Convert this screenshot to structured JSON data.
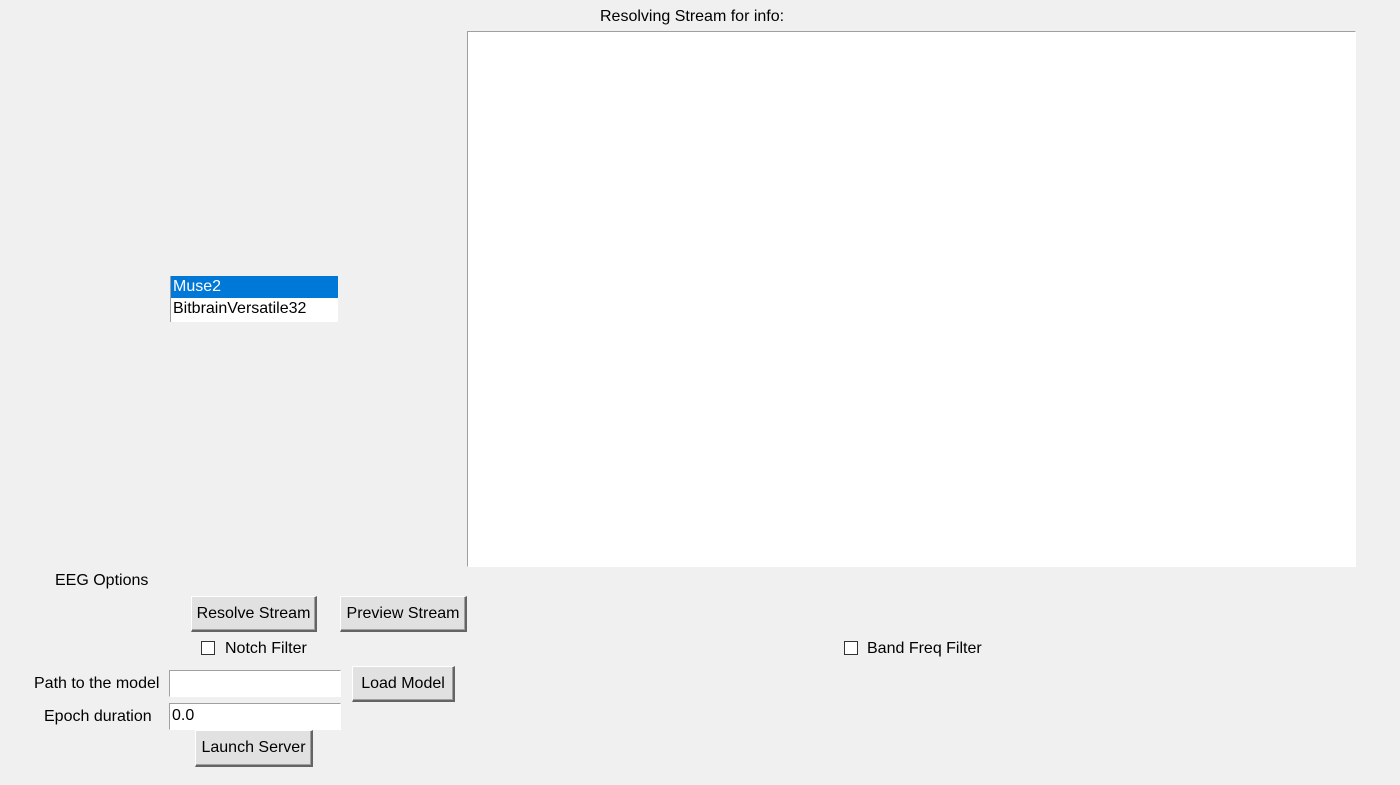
{
  "stream_info": {
    "title": "Resolving Stream for info:",
    "content": ""
  },
  "devices": {
    "items": [
      "Muse2",
      "BitbrainVersatile32"
    ],
    "selected_index": 0
  },
  "eeg_options": {
    "title": "EEG Options",
    "resolve_button": "Resolve Stream",
    "preview_button": "Preview Stream",
    "notch_filter": {
      "label": "Notch Filter",
      "checked": false
    },
    "band_filter": {
      "label": "Band Freq Filter",
      "checked": false
    }
  },
  "model": {
    "path_label": "Path to the model",
    "path_value": "",
    "load_button": "Load Model",
    "epoch_label": "Epoch duration",
    "epoch_value": "0.0",
    "launch_button": "Launch Server"
  }
}
